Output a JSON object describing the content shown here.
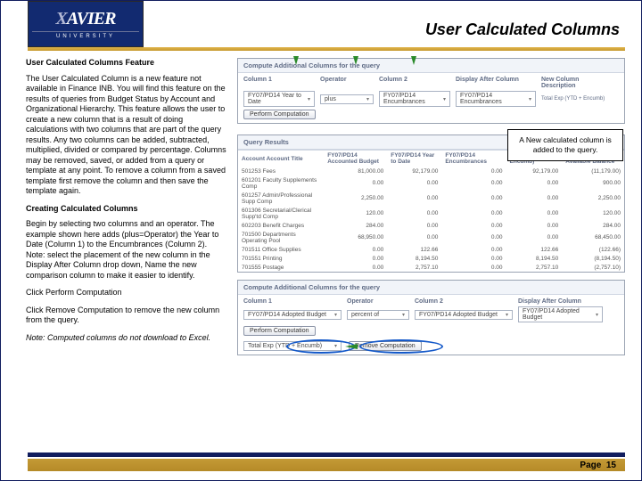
{
  "header": {
    "logo_text": "XAVIER",
    "logo_sub": "UNIVERSITY",
    "title": "User Calculated Columns"
  },
  "left": {
    "h1": "User Calculated Columns Feature",
    "p1": "The User Calculated Column is a new feature not available in Finance INB. You will find this feature on the results of queries from Budget Status by Account and Organizational Hierarchy. This feature allows the user to create a new column that is a result of doing calculations with two columns that are part of the query results. Any two columns can be added, subtracted, multiplied, divided or compared by percentage. Columns may be removed, saved, or added from a query or template at any point. To remove a column from a saved template first remove the column and then save the template again.",
    "h2": "Creating Calculated Columns",
    "p2": "Begin by selecting two columns and an operator. The example shown here adds (plus=Operator) the Year to Date (Column 1) to the Encumbrances (Column 2). Note: select the placement of the new column in the Display After Column drop down, Name the new comparison column to make it easier to identify.",
    "p3": "Click Perform Computation",
    "p4": "Click Remove Computation to remove the new column from the query.",
    "p5": "Note: Computed columns do not download to Excel."
  },
  "callout": "A New calculated column is added to the query.",
  "panel1": {
    "head": "Compute Additional Columns for the query",
    "cols": {
      "c1": "Column 1",
      "op": "Operator",
      "c2": "Column 2",
      "disp": "Display After Column",
      "desc": "New Column Description"
    },
    "v": {
      "c1": "FY07/PD14 Year to Date",
      "op": "plus",
      "c2": "FY07/PD14 Encumbrances",
      "disp": "FY07/PD14 Encumbrances",
      "desc": "Total Exp (YTD + Encumb)"
    },
    "btn": "Perform Computation"
  },
  "results": {
    "head": "Query Results",
    "headers": {
      "acct": "Account Account Title",
      "h1": "FY07/PD14 Accounted Budget",
      "h2": "FY07/PD14 Year to Date",
      "h3": "FY07/PD14 Encumbrances",
      "h4": "Total Exp (YTD + Encumb)",
      "h5": "FY07/PD14 Available Balance"
    },
    "rows": [
      {
        "a": "501253  Fees",
        "v": [
          "81,000.00",
          "92,179.00",
          "0.00",
          "92,179.00",
          "(11,179.00)"
        ]
      },
      {
        "a": "601201  Faculty Supplements Comp",
        "v": [
          "0.00",
          "0.00",
          "0.00",
          "0.00",
          "900.00"
        ]
      },
      {
        "a": "601257  Admin/Professional Supp Comp",
        "v": [
          "2,250.00",
          "0.00",
          "0.00",
          "0.00",
          "2,250.00"
        ]
      },
      {
        "a": "601306  Secretarial/Clerical Supp'td Comp",
        "v": [
          "120.00",
          "0.00",
          "0.00",
          "0.00",
          "120.00"
        ]
      },
      {
        "a": "602203  Benefit Charges",
        "v": [
          "284.00",
          "0.00",
          "0.00",
          "0.00",
          "284.00"
        ]
      },
      {
        "a": "701500  Departments Operating Pool",
        "v": [
          "68,950.00",
          "0.00",
          "0.00",
          "0.00",
          "68,450.00"
        ]
      },
      {
        "a": "701511  Office Supplies",
        "v": [
          "0.00",
          "122.66",
          "0.00",
          "122.66",
          "(122.66)"
        ]
      },
      {
        "a": "701551  Printing",
        "v": [
          "0.00",
          "8,194.50",
          "0.00",
          "8,194.50",
          "(8,194.50)"
        ]
      },
      {
        "a": "701555  Postage",
        "v": [
          "0.00",
          "2,757.10",
          "0.00",
          "2,757.10",
          "(2,757.10)"
        ]
      }
    ]
  },
  "panel2": {
    "head": "Compute Additional Columns for the query",
    "cols": {
      "c1": "Column 1",
      "op": "Operator",
      "c2": "Column 2",
      "disp": "Display After Column"
    },
    "v": {
      "c1": "FY07/PD14 Adopted Budget",
      "op": "percent of",
      "c2": "FY07/PD14 Adopted Budget",
      "disp": "FY07/PD14 Adopted Budget"
    },
    "btn1": "Perform Computation",
    "result_label": "Total Exp (YTD + Encumb)",
    "btn2": "Remove Computation"
  },
  "footer": {
    "page_label": "Page",
    "page_num": "15"
  }
}
